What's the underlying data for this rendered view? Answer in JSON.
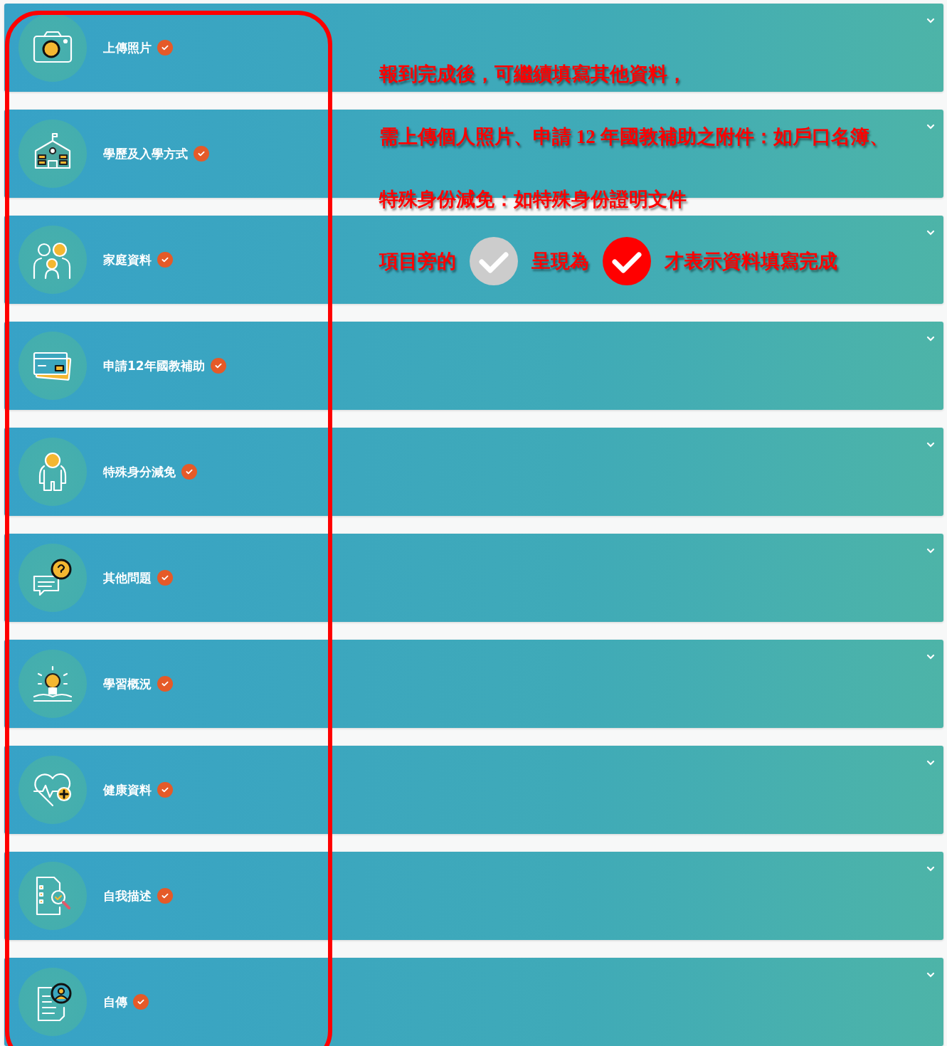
{
  "sections": [
    {
      "label": "上傳照片",
      "completed": true,
      "expanded": false
    },
    {
      "label": "學歷及入學方式",
      "completed": true,
      "expanded": false
    },
    {
      "label": "家庭資料",
      "completed": true,
      "expanded": false
    },
    {
      "label": "申請12年國教補助",
      "completed": true,
      "expanded": false
    },
    {
      "label": "特殊身分減免",
      "completed": true,
      "expanded": false
    },
    {
      "label": "其他問題",
      "completed": true,
      "expanded": false
    },
    {
      "label": "學習概況",
      "completed": true,
      "expanded": false
    },
    {
      "label": "健康資料",
      "completed": true,
      "expanded": false
    },
    {
      "label": "自我描述",
      "completed": true,
      "expanded": false
    },
    {
      "label": "自傳",
      "completed": true,
      "expanded": false
    }
  ],
  "annotation": {
    "lines": [
      "報到完成後，可繼續填寫其他資料，",
      "需上傳個人照片、申請 12 年國教補助之附件：如戶口名簿、",
      "特殊身份減免：如特殊身份證明文件"
    ],
    "legend": {
      "before": "項目旁的",
      "middle": "呈現為",
      "after": "才表示資料填寫完成"
    }
  }
}
